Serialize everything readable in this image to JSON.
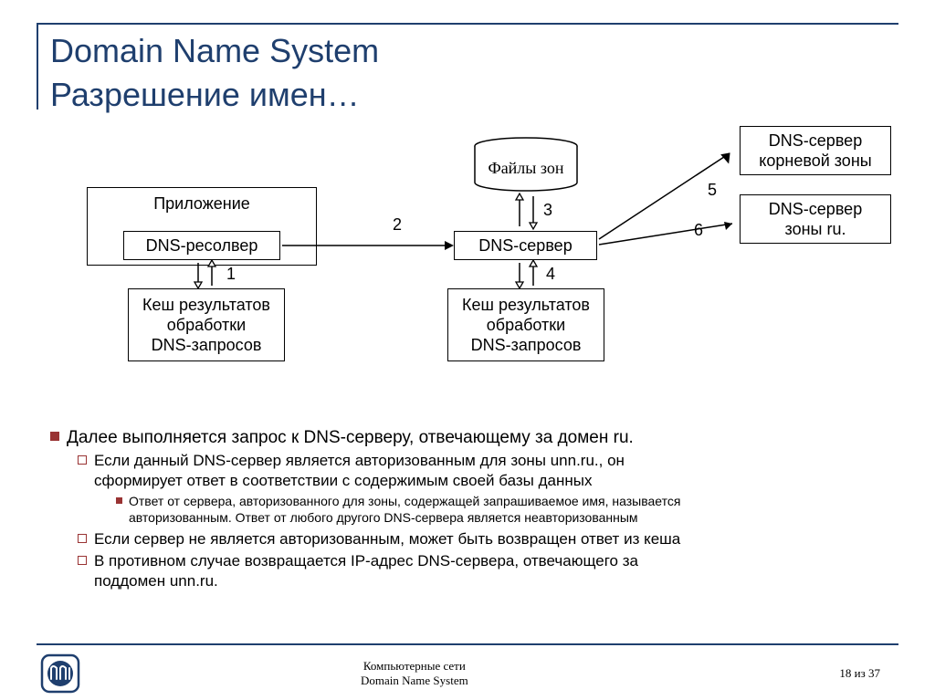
{
  "title_line1": "Domain Name System",
  "title_line2": "Разрешение имен…",
  "boxes": {
    "app": "Приложение",
    "resolver": "DNS-ресолвер",
    "cache1_l1": "Кеш результатов",
    "cache1_l2": "обработки",
    "cache1_l3": "DNS-запросов",
    "server": "DNS-сервер",
    "zoneFiles": "Файлы зон",
    "cache2_l1": "Кеш результатов",
    "cache2_l2": "обработки",
    "cache2_l3": "DNS-запросов",
    "root_l1": "DNS-сервер",
    "root_l2": "корневой зоны",
    "ru_l1": "DNS-сервер",
    "ru_l2": "зоны ru."
  },
  "labels": {
    "n1": "1",
    "n2": "2",
    "n3": "3",
    "n4": "4",
    "n5": "5",
    "n6": "6"
  },
  "bullets": {
    "b1": "Далее выполняется запрос к DNS-серверу, отвечающему за домен ru.",
    "b2a_l1": "Если данный DNS-сервер является авторизованным для зоны unn.ru., он",
    "b2a_l2": "сформирует ответ в соответствии с содержимым своей базы данных",
    "b3_l1": "Ответ от сервера, авторизованного для зоны, содержащей запрашиваемое имя, называется",
    "b3_l2": "авторизованным. Ответ от любого другого DNS-сервера является неавторизованным",
    "b2b": "Если сервер не является авторизованным, может быть возвращен ответ из кеша",
    "b2c_l1": "В противном случае возвращается IP-адрес DNS-сервера, отвечающего за",
    "b2c_l2": "поддомен unn.ru."
  },
  "footer": {
    "l1": "Компьютерные сети",
    "l2": "Domain Name System",
    "page": "18 из 37"
  }
}
